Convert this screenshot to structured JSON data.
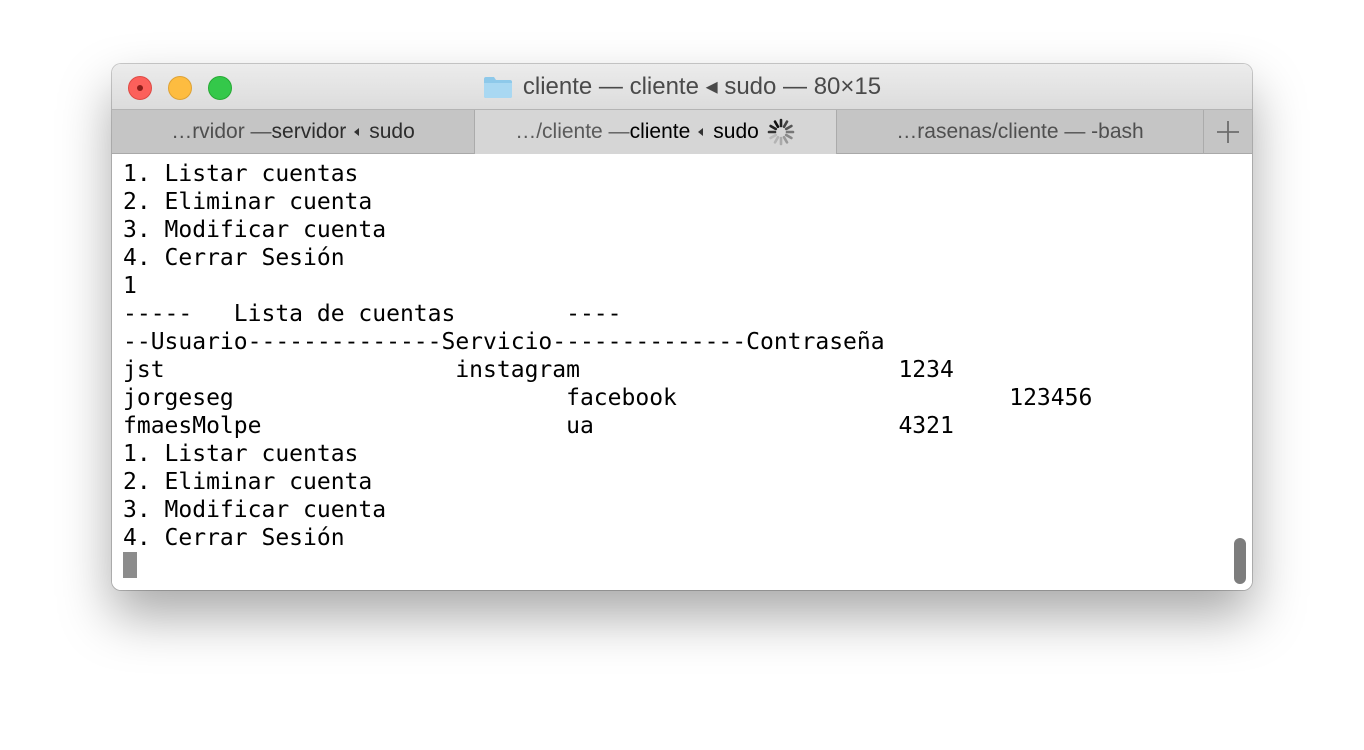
{
  "window": {
    "title": "cliente — cliente ◂ sudo — 80×15"
  },
  "tabs": [
    {
      "prefix": "…rvidor — ",
      "name": "servidor",
      "process": "sudo"
    },
    {
      "prefix": "…/cliente — ",
      "name": "cliente",
      "process": "sudo"
    },
    {
      "label": "…rasenas/cliente — -bash"
    }
  ],
  "terminal": {
    "lines": [
      "1. Listar cuentas",
      "2. Eliminar cuenta",
      "3. Modificar cuenta",
      "4. Cerrar Sesión",
      "1",
      "-----   Lista de cuentas        ----",
      "--Usuario--------------Servicio--------------Contraseña",
      "jst                     instagram                       1234",
      "jorgeseg                        facebook                        123456",
      "fmaesMolpe                      ua                      4321",
      "1. Listar cuentas",
      "2. Eliminar cuenta",
      "3. Modificar cuenta",
      "4. Cerrar Sesión"
    ]
  },
  "icons": {
    "folder": "folder-icon",
    "spinner": "activity-spinner-icon",
    "add_tab": "plus-icon"
  },
  "colors": {
    "close": "#fc605b",
    "minimize": "#fdbc40",
    "maximize": "#34c84a",
    "folder": "#8ec9ea"
  }
}
